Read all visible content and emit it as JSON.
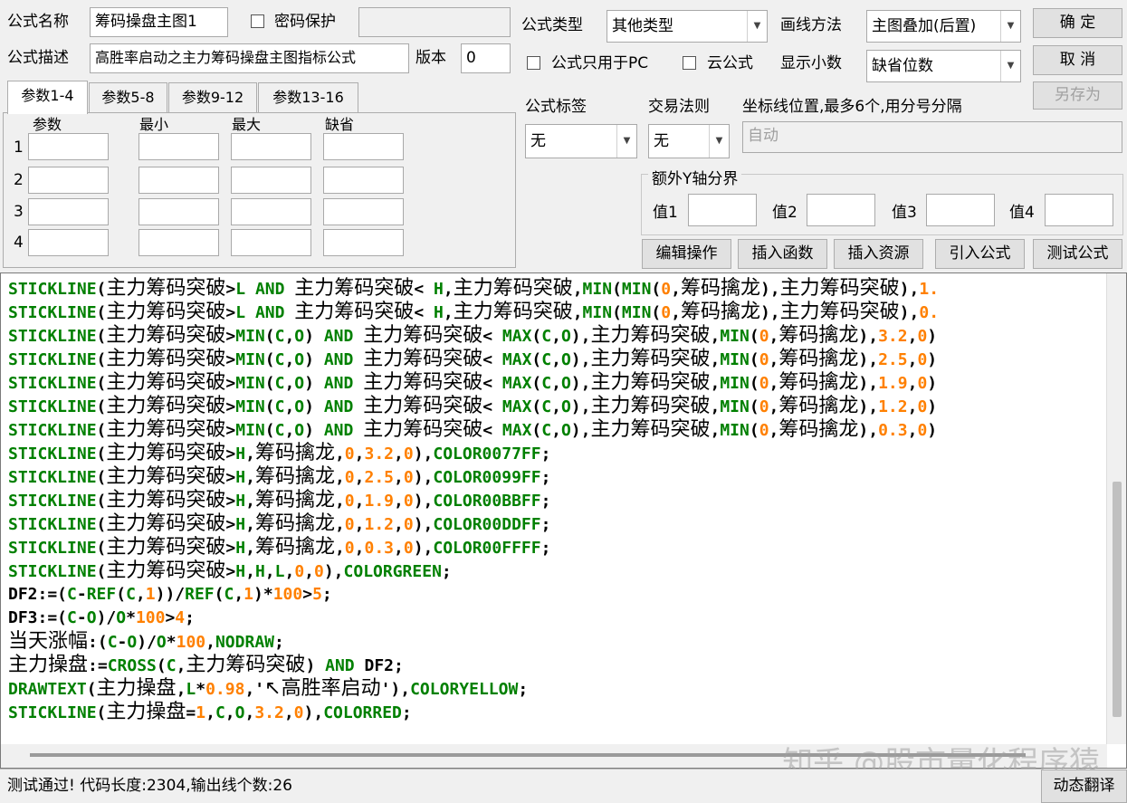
{
  "form": {
    "name_label": "公式名称",
    "name_value": "筹码操盘主图1",
    "password_label": "密码保护",
    "desc_label": "公式描述",
    "desc_value": "高胜率启动之主力筹码操盘主图指标公式",
    "version_label": "版本",
    "version_value": "0",
    "type_label": "公式类型",
    "type_value": "其他类型",
    "pc_only_label": "公式只用于PC",
    "cloud_label": "云公式",
    "draw_label": "画线方法",
    "draw_value": "主图叠加(后置)",
    "decimal_label": "显示小数",
    "decimal_value": "缺省位数"
  },
  "buttons": {
    "ok": "确  定",
    "cancel": "取  消",
    "save_as": "另存为",
    "edit": "编辑操作",
    "insert_func": "插入函数",
    "insert_res": "插入资源",
    "import": "引入公式",
    "test": "测试公式",
    "translate": "动态翻译"
  },
  "tabs": [
    "参数1-4",
    "参数5-8",
    "参数9-12",
    "参数13-16"
  ],
  "params": {
    "headers": [
      "参数",
      "最小",
      "最大",
      "缺省"
    ],
    "rows": [
      "1",
      "2",
      "3",
      "4"
    ]
  },
  "tag": {
    "label": "公式标签",
    "value": "无"
  },
  "trade": {
    "label": "交易法则",
    "value": "无"
  },
  "axis": {
    "label": "坐标线位置,最多6个,用分号分隔",
    "value": "自动"
  },
  "yaxis": {
    "title": "额外Y轴分界",
    "labels": [
      "值1",
      "值2",
      "值3",
      "值4"
    ]
  },
  "code_lines": [
    [
      [
        "g",
        "STICKLINE"
      ],
      [
        "k",
        "("
      ],
      [
        "cn",
        "主力筹码突破"
      ],
      [
        "k",
        ">"
      ],
      [
        "g",
        "L"
      ],
      [
        "k",
        " "
      ],
      [
        "g",
        "AND"
      ],
      [
        "k",
        " "
      ],
      [
        "cn",
        "主力筹码突破"
      ],
      [
        "k",
        "< "
      ],
      [
        "g",
        "H"
      ],
      [
        "k",
        ","
      ],
      [
        "cn",
        "主力筹码突破"
      ],
      [
        "k",
        ","
      ],
      [
        "g",
        "MIN"
      ],
      [
        "k",
        "("
      ],
      [
        "g",
        "MIN"
      ],
      [
        "k",
        "("
      ],
      [
        "o",
        "0"
      ],
      [
        "k",
        ","
      ],
      [
        "cn",
        "筹码擒龙"
      ],
      [
        "k",
        "),"
      ],
      [
        "cn",
        "主力筹码突破"
      ],
      [
        "k",
        "),"
      ],
      [
        "o",
        "1."
      ]
    ],
    [
      [
        "g",
        "STICKLINE"
      ],
      [
        "k",
        "("
      ],
      [
        "cn",
        "主力筹码突破"
      ],
      [
        "k",
        ">"
      ],
      [
        "g",
        "L"
      ],
      [
        "k",
        " "
      ],
      [
        "g",
        "AND"
      ],
      [
        "k",
        " "
      ],
      [
        "cn",
        "主力筹码突破"
      ],
      [
        "k",
        "< "
      ],
      [
        "g",
        "H"
      ],
      [
        "k",
        ","
      ],
      [
        "cn",
        "主力筹码突破"
      ],
      [
        "k",
        ","
      ],
      [
        "g",
        "MIN"
      ],
      [
        "k",
        "("
      ],
      [
        "g",
        "MIN"
      ],
      [
        "k",
        "("
      ],
      [
        "o",
        "0"
      ],
      [
        "k",
        ","
      ],
      [
        "cn",
        "筹码擒龙"
      ],
      [
        "k",
        "),"
      ],
      [
        "cn",
        "主力筹码突破"
      ],
      [
        "k",
        "),"
      ],
      [
        "o",
        "0."
      ]
    ],
    [
      [
        "g",
        "STICKLINE"
      ],
      [
        "k",
        "("
      ],
      [
        "cn",
        "主力筹码突破"
      ],
      [
        "k",
        ">"
      ],
      [
        "g",
        "MIN"
      ],
      [
        "k",
        "("
      ],
      [
        "g",
        "C"
      ],
      [
        "k",
        ","
      ],
      [
        "g",
        "O"
      ],
      [
        "k",
        ") "
      ],
      [
        "g",
        "AND"
      ],
      [
        "k",
        " "
      ],
      [
        "cn",
        "主力筹码突破"
      ],
      [
        "k",
        "< "
      ],
      [
        "g",
        "MAX"
      ],
      [
        "k",
        "("
      ],
      [
        "g",
        "C"
      ],
      [
        "k",
        ","
      ],
      [
        "g",
        "O"
      ],
      [
        "k",
        "),"
      ],
      [
        "cn",
        "主力筹码突破"
      ],
      [
        "k",
        ","
      ],
      [
        "g",
        "MIN"
      ],
      [
        "k",
        "("
      ],
      [
        "o",
        "0"
      ],
      [
        "k",
        ","
      ],
      [
        "cn",
        "筹码擒龙"
      ],
      [
        "k",
        "),"
      ],
      [
        "o",
        "3.2"
      ],
      [
        "k",
        ","
      ],
      [
        "o",
        "0"
      ],
      [
        "k",
        ")"
      ]
    ],
    [
      [
        "g",
        "STICKLINE"
      ],
      [
        "k",
        "("
      ],
      [
        "cn",
        "主力筹码突破"
      ],
      [
        "k",
        ">"
      ],
      [
        "g",
        "MIN"
      ],
      [
        "k",
        "("
      ],
      [
        "g",
        "C"
      ],
      [
        "k",
        ","
      ],
      [
        "g",
        "O"
      ],
      [
        "k",
        ") "
      ],
      [
        "g",
        "AND"
      ],
      [
        "k",
        " "
      ],
      [
        "cn",
        "主力筹码突破"
      ],
      [
        "k",
        "< "
      ],
      [
        "g",
        "MAX"
      ],
      [
        "k",
        "("
      ],
      [
        "g",
        "C"
      ],
      [
        "k",
        ","
      ],
      [
        "g",
        "O"
      ],
      [
        "k",
        "),"
      ],
      [
        "cn",
        "主力筹码突破"
      ],
      [
        "k",
        ","
      ],
      [
        "g",
        "MIN"
      ],
      [
        "k",
        "("
      ],
      [
        "o",
        "0"
      ],
      [
        "k",
        ","
      ],
      [
        "cn",
        "筹码擒龙"
      ],
      [
        "k",
        "),"
      ],
      [
        "o",
        "2.5"
      ],
      [
        "k",
        ","
      ],
      [
        "o",
        "0"
      ],
      [
        "k",
        ")"
      ]
    ],
    [
      [
        "g",
        "STICKLINE"
      ],
      [
        "k",
        "("
      ],
      [
        "cn",
        "主力筹码突破"
      ],
      [
        "k",
        ">"
      ],
      [
        "g",
        "MIN"
      ],
      [
        "k",
        "("
      ],
      [
        "g",
        "C"
      ],
      [
        "k",
        ","
      ],
      [
        "g",
        "O"
      ],
      [
        "k",
        ") "
      ],
      [
        "g",
        "AND"
      ],
      [
        "k",
        " "
      ],
      [
        "cn",
        "主力筹码突破"
      ],
      [
        "k",
        "< "
      ],
      [
        "g",
        "MAX"
      ],
      [
        "k",
        "("
      ],
      [
        "g",
        "C"
      ],
      [
        "k",
        ","
      ],
      [
        "g",
        "O"
      ],
      [
        "k",
        "),"
      ],
      [
        "cn",
        "主力筹码突破"
      ],
      [
        "k",
        ","
      ],
      [
        "g",
        "MIN"
      ],
      [
        "k",
        "("
      ],
      [
        "o",
        "0"
      ],
      [
        "k",
        ","
      ],
      [
        "cn",
        "筹码擒龙"
      ],
      [
        "k",
        "),"
      ],
      [
        "o",
        "1.9"
      ],
      [
        "k",
        ","
      ],
      [
        "o",
        "0"
      ],
      [
        "k",
        ")"
      ]
    ],
    [
      [
        "g",
        "STICKLINE"
      ],
      [
        "k",
        "("
      ],
      [
        "cn",
        "主力筹码突破"
      ],
      [
        "k",
        ">"
      ],
      [
        "g",
        "MIN"
      ],
      [
        "k",
        "("
      ],
      [
        "g",
        "C"
      ],
      [
        "k",
        ","
      ],
      [
        "g",
        "O"
      ],
      [
        "k",
        ") "
      ],
      [
        "g",
        "AND"
      ],
      [
        "k",
        " "
      ],
      [
        "cn",
        "主力筹码突破"
      ],
      [
        "k",
        "< "
      ],
      [
        "g",
        "MAX"
      ],
      [
        "k",
        "("
      ],
      [
        "g",
        "C"
      ],
      [
        "k",
        ","
      ],
      [
        "g",
        "O"
      ],
      [
        "k",
        "),"
      ],
      [
        "cn",
        "主力筹码突破"
      ],
      [
        "k",
        ","
      ],
      [
        "g",
        "MIN"
      ],
      [
        "k",
        "("
      ],
      [
        "o",
        "0"
      ],
      [
        "k",
        ","
      ],
      [
        "cn",
        "筹码擒龙"
      ],
      [
        "k",
        "),"
      ],
      [
        "o",
        "1.2"
      ],
      [
        "k",
        ","
      ],
      [
        "o",
        "0"
      ],
      [
        "k",
        ")"
      ]
    ],
    [
      [
        "g",
        "STICKLINE"
      ],
      [
        "k",
        "("
      ],
      [
        "cn",
        "主力筹码突破"
      ],
      [
        "k",
        ">"
      ],
      [
        "g",
        "MIN"
      ],
      [
        "k",
        "("
      ],
      [
        "g",
        "C"
      ],
      [
        "k",
        ","
      ],
      [
        "g",
        "O"
      ],
      [
        "k",
        ") "
      ],
      [
        "g",
        "AND"
      ],
      [
        "k",
        " "
      ],
      [
        "cn",
        "主力筹码突破"
      ],
      [
        "k",
        "< "
      ],
      [
        "g",
        "MAX"
      ],
      [
        "k",
        "("
      ],
      [
        "g",
        "C"
      ],
      [
        "k",
        ","
      ],
      [
        "g",
        "O"
      ],
      [
        "k",
        "),"
      ],
      [
        "cn",
        "主力筹码突破"
      ],
      [
        "k",
        ","
      ],
      [
        "g",
        "MIN"
      ],
      [
        "k",
        "("
      ],
      [
        "o",
        "0"
      ],
      [
        "k",
        ","
      ],
      [
        "cn",
        "筹码擒龙"
      ],
      [
        "k",
        "),"
      ],
      [
        "o",
        "0.3"
      ],
      [
        "k",
        ","
      ],
      [
        "o",
        "0"
      ],
      [
        "k",
        ")"
      ]
    ],
    [
      [
        "g",
        "STICKLINE"
      ],
      [
        "k",
        "("
      ],
      [
        "cn",
        "主力筹码突破"
      ],
      [
        "k",
        ">"
      ],
      [
        "g",
        "H"
      ],
      [
        "k",
        ","
      ],
      [
        "cn",
        "筹码擒龙"
      ],
      [
        "k",
        ","
      ],
      [
        "o",
        "0"
      ],
      [
        "k",
        ","
      ],
      [
        "o",
        "3.2"
      ],
      [
        "k",
        ","
      ],
      [
        "o",
        "0"
      ],
      [
        "k",
        "),"
      ],
      [
        "g",
        "COLOR0077FF"
      ],
      [
        "k",
        ";"
      ]
    ],
    [
      [
        "g",
        "STICKLINE"
      ],
      [
        "k",
        "("
      ],
      [
        "cn",
        "主力筹码突破"
      ],
      [
        "k",
        ">"
      ],
      [
        "g",
        "H"
      ],
      [
        "k",
        ","
      ],
      [
        "cn",
        "筹码擒龙"
      ],
      [
        "k",
        ","
      ],
      [
        "o",
        "0"
      ],
      [
        "k",
        ","
      ],
      [
        "o",
        "2.5"
      ],
      [
        "k",
        ","
      ],
      [
        "o",
        "0"
      ],
      [
        "k",
        "),"
      ],
      [
        "g",
        "COLOR0099FF"
      ],
      [
        "k",
        ";"
      ]
    ],
    [
      [
        "g",
        "STICKLINE"
      ],
      [
        "k",
        "("
      ],
      [
        "cn",
        "主力筹码突破"
      ],
      [
        "k",
        ">"
      ],
      [
        "g",
        "H"
      ],
      [
        "k",
        ","
      ],
      [
        "cn",
        "筹码擒龙"
      ],
      [
        "k",
        ","
      ],
      [
        "o",
        "0"
      ],
      [
        "k",
        ","
      ],
      [
        "o",
        "1.9"
      ],
      [
        "k",
        ","
      ],
      [
        "o",
        "0"
      ],
      [
        "k",
        "),"
      ],
      [
        "g",
        "COLOR00BBFF"
      ],
      [
        "k",
        ";"
      ]
    ],
    [
      [
        "g",
        "STICKLINE"
      ],
      [
        "k",
        "("
      ],
      [
        "cn",
        "主力筹码突破"
      ],
      [
        "k",
        ">"
      ],
      [
        "g",
        "H"
      ],
      [
        "k",
        ","
      ],
      [
        "cn",
        "筹码擒龙"
      ],
      [
        "k",
        ","
      ],
      [
        "o",
        "0"
      ],
      [
        "k",
        ","
      ],
      [
        "o",
        "1.2"
      ],
      [
        "k",
        ","
      ],
      [
        "o",
        "0"
      ],
      [
        "k",
        "),"
      ],
      [
        "g",
        "COLOR00DDFF"
      ],
      [
        "k",
        ";"
      ]
    ],
    [
      [
        "g",
        "STICKLINE"
      ],
      [
        "k",
        "("
      ],
      [
        "cn",
        "主力筹码突破"
      ],
      [
        "k",
        ">"
      ],
      [
        "g",
        "H"
      ],
      [
        "k",
        ","
      ],
      [
        "cn",
        "筹码擒龙"
      ],
      [
        "k",
        ","
      ],
      [
        "o",
        "0"
      ],
      [
        "k",
        ","
      ],
      [
        "o",
        "0.3"
      ],
      [
        "k",
        ","
      ],
      [
        "o",
        "0"
      ],
      [
        "k",
        "),"
      ],
      [
        "g",
        "COLOR00FFFF"
      ],
      [
        "k",
        ";"
      ]
    ],
    [
      [
        "g",
        "STICKLINE"
      ],
      [
        "k",
        "("
      ],
      [
        "cn",
        "主力筹码突破"
      ],
      [
        "k",
        ">"
      ],
      [
        "g",
        "H"
      ],
      [
        "k",
        ","
      ],
      [
        "g",
        "H"
      ],
      [
        "k",
        ","
      ],
      [
        "g",
        "L"
      ],
      [
        "k",
        ","
      ],
      [
        "o",
        "0"
      ],
      [
        "k",
        ","
      ],
      [
        "o",
        "0"
      ],
      [
        "k",
        "),"
      ],
      [
        "g",
        "COLORGREEN"
      ],
      [
        "k",
        ";"
      ]
    ],
    [
      [
        "k",
        "DF2:=("
      ],
      [
        "g",
        "C"
      ],
      [
        "k",
        "-"
      ],
      [
        "g",
        "REF"
      ],
      [
        "k",
        "("
      ],
      [
        "g",
        "C"
      ],
      [
        "k",
        ","
      ],
      [
        "o",
        "1"
      ],
      [
        "k",
        "))/"
      ],
      [
        "g",
        "REF"
      ],
      [
        "k",
        "("
      ],
      [
        "g",
        "C"
      ],
      [
        "k",
        ","
      ],
      [
        "o",
        "1"
      ],
      [
        "k",
        ")*"
      ],
      [
        "o",
        "100"
      ],
      [
        "k",
        ">"
      ],
      [
        "o",
        "5"
      ],
      [
        "k",
        ";"
      ]
    ],
    [
      [
        "k",
        "DF3:=("
      ],
      [
        "g",
        "C"
      ],
      [
        "k",
        "-"
      ],
      [
        "g",
        "O"
      ],
      [
        "k",
        ")/"
      ],
      [
        "g",
        "O"
      ],
      [
        "k",
        "*"
      ],
      [
        "o",
        "100"
      ],
      [
        "k",
        ">"
      ],
      [
        "o",
        "4"
      ],
      [
        "k",
        ";"
      ]
    ],
    [
      [
        "cn",
        "当天涨幅"
      ],
      [
        "k",
        ":("
      ],
      [
        "g",
        "C"
      ],
      [
        "k",
        "-"
      ],
      [
        "g",
        "O"
      ],
      [
        "k",
        ")/"
      ],
      [
        "g",
        "O"
      ],
      [
        "k",
        "*"
      ],
      [
        "o",
        "100"
      ],
      [
        "k",
        ","
      ],
      [
        "g",
        "NODRAW"
      ],
      [
        "k",
        ";"
      ]
    ],
    [
      [
        "cn",
        "主力操盘"
      ],
      [
        "k",
        ":="
      ],
      [
        "g",
        "CROSS"
      ],
      [
        "k",
        "("
      ],
      [
        "g",
        "C"
      ],
      [
        "k",
        ","
      ],
      [
        "cn",
        "主力筹码突破"
      ],
      [
        "k",
        ") "
      ],
      [
        "g",
        "AND"
      ],
      [
        "k",
        " DF2;"
      ]
    ],
    [
      [
        "g",
        "DRAWTEXT"
      ],
      [
        "k",
        "("
      ],
      [
        "cn",
        "主力操盘"
      ],
      [
        "k",
        ","
      ],
      [
        "g",
        "L"
      ],
      [
        "k",
        "*"
      ],
      [
        "o",
        "0.98"
      ],
      [
        "k",
        ",'"
      ],
      [
        "cn",
        "↖高胜率启动"
      ],
      [
        "k",
        "'),"
      ],
      [
        "g",
        "COLORYELLOW"
      ],
      [
        "k",
        ";"
      ]
    ],
    [
      [
        "g",
        "STICKLINE"
      ],
      [
        "k",
        "("
      ],
      [
        "cn",
        "主力操盘"
      ],
      [
        "k",
        "="
      ],
      [
        "o",
        "1"
      ],
      [
        "k",
        ","
      ],
      [
        "g",
        "C"
      ],
      [
        "k",
        ","
      ],
      [
        "g",
        "O"
      ],
      [
        "k",
        ","
      ],
      [
        "o",
        "3.2"
      ],
      [
        "k",
        ","
      ],
      [
        "o",
        "0"
      ],
      [
        "k",
        "),"
      ],
      [
        "g",
        "COLORRED"
      ],
      [
        "k",
        ";"
      ]
    ]
  ],
  "status": "测试通过! 代码长度:2304,输出线个数:26",
  "watermark": "知乎 @股市量化程序猿"
}
